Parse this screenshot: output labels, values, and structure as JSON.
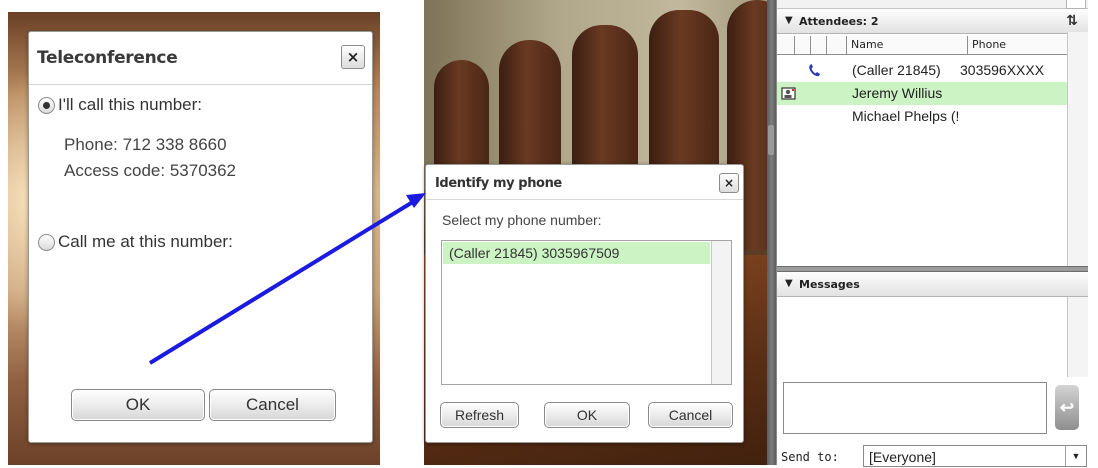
{
  "teleconference": {
    "title": "Teleconference",
    "close": "×",
    "option_call_this": "I'll call this number:",
    "phone_line": "Phone: 712 338 8660",
    "access_line": "Access code: 5370362",
    "option_call_me": "Call me at this number:",
    "ok": "OK",
    "cancel": "Cancel"
  },
  "identify": {
    "title": "Identify my phone",
    "close": "×",
    "prompt": "Select my phone number:",
    "numbers": [
      "(Caller 21845) 3035967509"
    ],
    "refresh": "Refresh",
    "ok": "OK",
    "cancel": "Cancel"
  },
  "attendees": {
    "header": "Attendees: 2",
    "col_name": "Name",
    "col_phone": "Phone",
    "rows": [
      {
        "name": "(Caller 21845)",
        "phone": "303596XXXX",
        "icon": "phone-icon"
      },
      {
        "name": "Jeremy Willius",
        "phone": "",
        "icon": "webcam-user-icon"
      },
      {
        "name": "Michael Phelps (!",
        "phone": "",
        "icon": ""
      }
    ]
  },
  "messages": {
    "header": "Messages",
    "send_to_label": "Send to:",
    "send_to_value": "[Everyone]",
    "send_icon": "↩"
  },
  "colors": {
    "selection_green": "#ccf3c3",
    "arrow_blue": "#1a1ae0"
  }
}
